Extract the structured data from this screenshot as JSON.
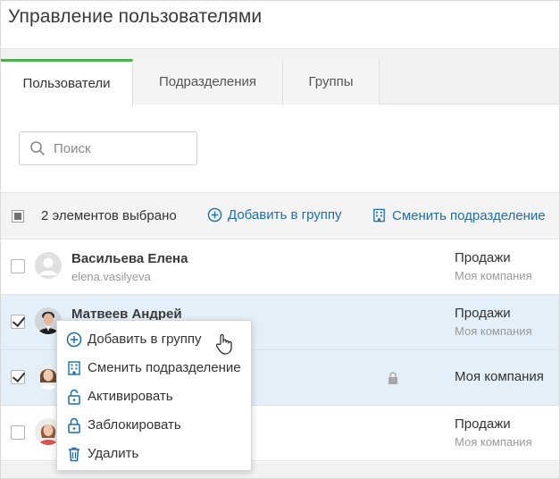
{
  "page": {
    "title": "Управление пользователями"
  },
  "tabs": [
    {
      "label": "Пользователи",
      "active": true
    },
    {
      "label": "Подразделения",
      "active": false
    },
    {
      "label": "Группы",
      "active": false
    }
  ],
  "search": {
    "placeholder": "Поиск",
    "value": ""
  },
  "actionbar": {
    "selected_count": "2 элементов выбрано",
    "add_to_group": "Добавить в группу",
    "change_department": "Сменить подразделение"
  },
  "users": [
    {
      "name": "Васильева Елена",
      "login": "elena.vasilyeva",
      "department": "Продажи",
      "company": "Моя компания",
      "checked": false,
      "avatar": "default-avatar"
    },
    {
      "name": "Матвеев Андрей",
      "login": "",
      "department": "Продажи",
      "company": "Моя компания",
      "checked": true,
      "avatar": "male-photo"
    },
    {
      "name": "",
      "login": "",
      "department": "Моя компания",
      "company": "",
      "checked": true,
      "avatar": "female-photo",
      "locked": true
    },
    {
      "name": "",
      "login": "",
      "department": "Продажи",
      "company": "Моя компания",
      "checked": false,
      "avatar": "female-photo-2"
    }
  ],
  "context_menu": {
    "items": [
      {
        "label": "Добавить в группу",
        "icon": "plus-circle-icon"
      },
      {
        "label": "Сменить подразделение",
        "icon": "building-icon"
      },
      {
        "label": "Активировать",
        "icon": "unlock-icon"
      },
      {
        "label": "Заблокировать",
        "icon": "lock-icon"
      },
      {
        "label": "Удалить",
        "icon": "trash-icon"
      }
    ]
  },
  "colors": {
    "accent": "#1d6fa5",
    "active_tab": "#4caf50",
    "selected_row": "#e3eff9"
  }
}
